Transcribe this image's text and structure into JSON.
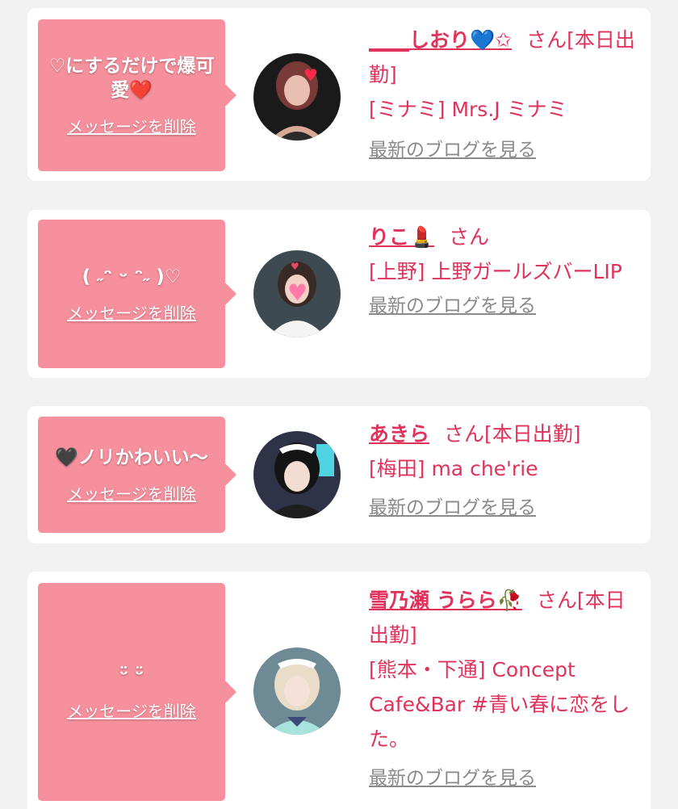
{
  "colors": {
    "accent": "#e0335c",
    "bubble": "#f6909d",
    "muted": "#8a8a8a",
    "background": "#f1f1f1"
  },
  "cards": [
    {
      "message": "♡にするだけで爆可愛❤️",
      "delete_label": "メッセージを削除",
      "name": "____しおり💙✩",
      "san": "さん",
      "status": "[本日出勤]",
      "shop": "[ミナミ] Mrs.J ミナミ",
      "blog_label": "最新のブログを見る"
    },
    {
      "message": "( ˶ᵔ ᵕ ᵔ˶ )♡",
      "delete_label": "メッセージを削除",
      "name": "りこ💄",
      "san": "さん",
      "status": "",
      "shop": "[上野] 上野ガールズバーLIP",
      "blog_label": "最新のブログを見る"
    },
    {
      "message": "🖤ノリかわいい〜",
      "delete_label": "メッセージを削除",
      "name": "あきら",
      "san": "さん",
      "status": "[本日出勤]",
      "shop": "[梅田] ma che'rie",
      "blog_label": "最新のブログを見る"
    },
    {
      "message": "ᵕ̈ ᵕ̈",
      "delete_label": "メッセージを削除",
      "name": "雪乃瀬 うらら🥀",
      "san": "さん",
      "status": "[本日出勤]",
      "shop": "[熊本・下通] Concept Cafe&Bar #青い春に恋をした。",
      "blog_label": "最新のブログを見る"
    }
  ]
}
